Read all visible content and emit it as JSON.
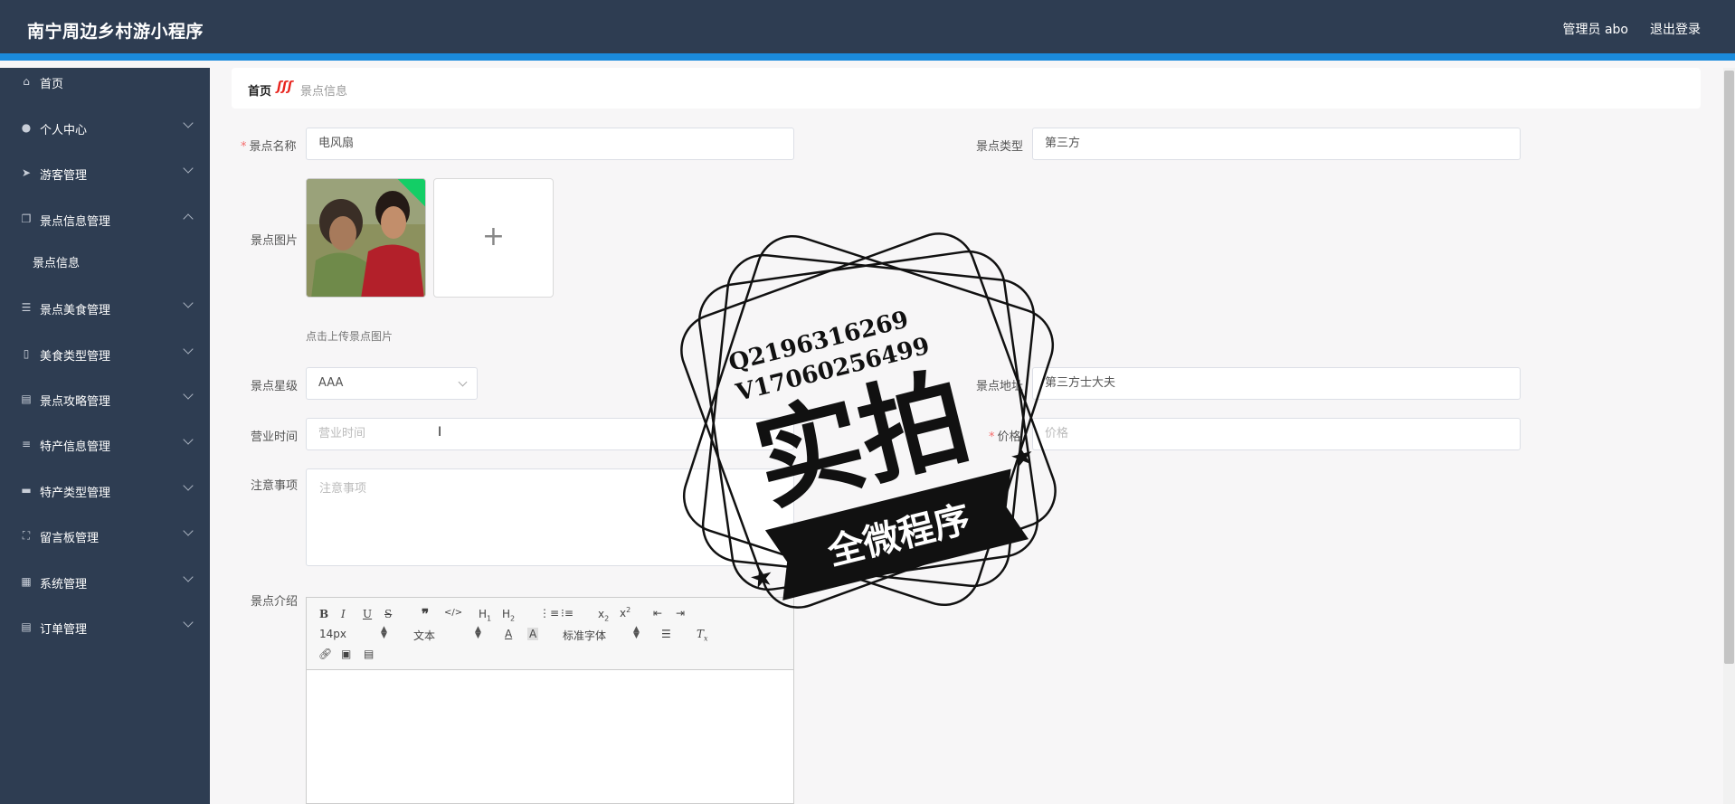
{
  "header": {
    "title": "南宁周边乡村游小程序",
    "user": "管理员 abo",
    "logout": "退出登录"
  },
  "sidebar": {
    "items": [
      {
        "label": "首页",
        "icon": "home-icon"
      },
      {
        "label": "个人中心",
        "icon": "user-icon"
      },
      {
        "label": "游客管理",
        "icon": "send-icon"
      },
      {
        "label": "景点信息管理",
        "icon": "copy-icon"
      },
      {
        "label": "景点信息",
        "icon": ""
      },
      {
        "label": "景点美食管理",
        "icon": "sliders-icon"
      },
      {
        "label": "美食类型管理",
        "icon": "mic-icon"
      },
      {
        "label": "景点攻略管理",
        "icon": "clipboard-icon"
      },
      {
        "label": "特产信息管理",
        "icon": "list-icon"
      },
      {
        "label": "特产类型管理",
        "icon": "printer-icon"
      },
      {
        "label": "留言板管理",
        "icon": "fullscreen-icon"
      },
      {
        "label": "系统管理",
        "icon": "grid-icon"
      },
      {
        "label": "订单管理",
        "icon": "clipboard-icon"
      }
    ]
  },
  "breadcrumb": {
    "home": "首页",
    "current": "景点信息"
  },
  "form": {
    "name_label": "景点名称",
    "name_value": "电风扇",
    "type_label": "景点类型",
    "type_value": "第三方",
    "image_label": "景点图片",
    "upload_tip": "点击上传景点图片",
    "star_label": "景点星级",
    "star_value": "AAA",
    "address_label": "景点地址",
    "address_value": "第三方士大夫",
    "hours_label": "营业时间",
    "hours_placeholder": "营业时间",
    "price_label": "价格",
    "price_placeholder": "价格",
    "notice_label": "注意事项",
    "notice_placeholder": "注意事项",
    "intro_label": "景点介绍"
  },
  "editor": {
    "font_size": "14px",
    "block_type": "文本",
    "font_family": "标准字体"
  },
  "watermark": {
    "line1": "Q2196316269",
    "line2": "V17060256499",
    "main": "实拍",
    "banner": "全微程序"
  }
}
